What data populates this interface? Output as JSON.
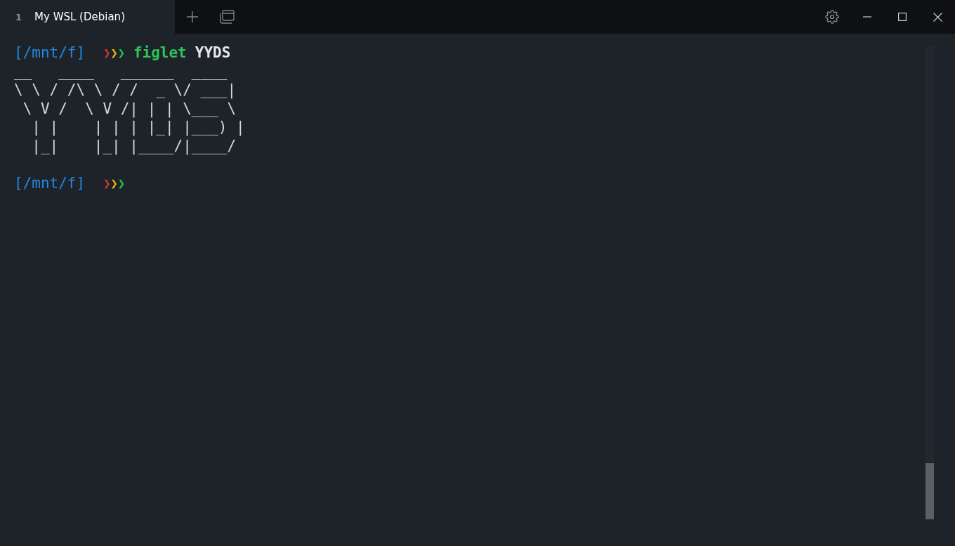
{
  "tabs": [
    {
      "number": "1",
      "title": "My WSL (Debian)",
      "selected": true
    }
  ],
  "terminal": {
    "lines": [
      {
        "kind": "prompt",
        "path": "[/mnt/f]",
        "arrows": [
          {
            "glyph": "❯",
            "color": "#e0352b"
          },
          {
            "glyph": "❯",
            "color": "#f2b705"
          },
          {
            "glyph": "❯",
            "color": "#22c55e"
          }
        ],
        "command": "figlet",
        "argument": "YYDS"
      },
      {
        "kind": "output",
        "text": "__   ____   ______  ____  "
      },
      {
        "kind": "output",
        "text": "\\ \\ / /\\ \\ / /  _ \\/ ___| "
      },
      {
        "kind": "output",
        "text": " \\ V /  \\ V /| | | \\___ \\ "
      },
      {
        "kind": "output",
        "text": "  | |    | | | |_| |___) |"
      },
      {
        "kind": "output",
        "text": "  |_|    |_| |____/|____/ "
      },
      {
        "kind": "blank"
      },
      {
        "kind": "prompt",
        "path": "[/mnt/f]",
        "arrows": [
          {
            "glyph": "❯",
            "color": "#e0352b"
          },
          {
            "glyph": "❯",
            "color": "#f2b705"
          },
          {
            "glyph": "❯",
            "color": "#22c55e"
          }
        ]
      }
    ]
  }
}
